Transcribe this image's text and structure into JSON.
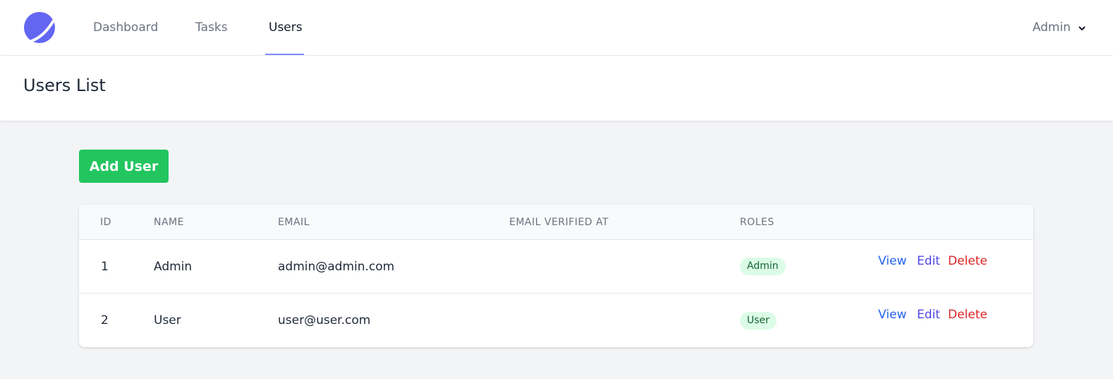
{
  "nav": {
    "links": [
      {
        "label": "Dashboard",
        "active": false
      },
      {
        "label": "Tasks",
        "active": false
      },
      {
        "label": "Users",
        "active": true
      }
    ],
    "user_menu": {
      "label": "Admin"
    }
  },
  "header": {
    "title": "Users List"
  },
  "toolbar": {
    "add_label": "Add User"
  },
  "table": {
    "columns": [
      "ID",
      "NAME",
      "EMAIL",
      "EMAIL VERIFIED AT",
      "ROLES"
    ],
    "rows": [
      {
        "id": "1",
        "name": "Admin",
        "email": "admin@admin.com",
        "email_verified_at": "",
        "role": "Admin"
      },
      {
        "id": "2",
        "name": "User",
        "email": "user@user.com",
        "email_verified_at": "",
        "role": "User"
      }
    ],
    "actions": {
      "view": "View",
      "edit": "Edit",
      "delete": "Delete"
    }
  },
  "colors": {
    "accent": "#818cf8",
    "logo": "#6366f1",
    "add_button": "#22c55e",
    "badge_bg": "#dcfce7",
    "badge_text": "#166534",
    "view": "#2563eb",
    "edit": "#4f46e5",
    "delete": "#dc2626"
  },
  "icons": {
    "logo": "planet-logo-icon",
    "user_menu": "chevron-down-icon"
  }
}
